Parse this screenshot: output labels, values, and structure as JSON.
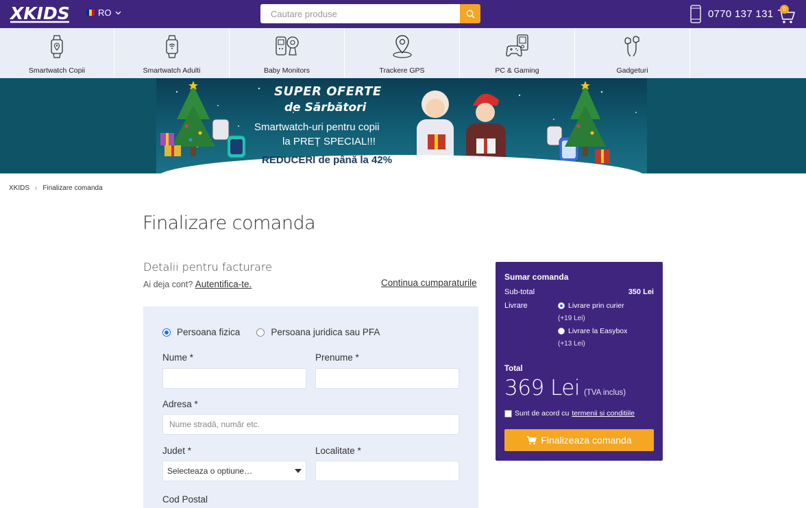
{
  "header": {
    "logo_text": "XKIDS",
    "language": "RO",
    "search_placeholder": "Cautare produse",
    "phone": "0770 137 131",
    "cart_count": "0"
  },
  "categories": [
    {
      "label": "Smartwatch Copii",
      "icon": "smartwatch-pin-icon"
    },
    {
      "label": "Smartwatch Adulti",
      "icon": "smartwatch-wifi-icon"
    },
    {
      "label": "Baby Monitors",
      "icon": "baby-monitor-icon"
    },
    {
      "label": "Trackere GPS",
      "icon": "gps-pin-icon"
    },
    {
      "label": "PC & Gaming",
      "icon": "gamepad-icon"
    },
    {
      "label": "Gadgeturi",
      "icon": "earphones-icon"
    }
  ],
  "banner": {
    "title_line1": "SUPER OFERTE",
    "title_line2": "de Sărbători",
    "sub_line1": "Smartwatch-uri pentru copii",
    "sub_line2": "la PREȚ SPECIAL!!!",
    "sub_line3": "REDUCERI de până la 42%"
  },
  "breadcrumb": {
    "home": "XKIDS",
    "current": "Finalizare comanda"
  },
  "page": {
    "title": "Finalizare comanda",
    "billing_title": "Detalii pentru facturare",
    "account_prompt": "Ai deja cont?",
    "login_link": "Autentifica-te.",
    "continue_link": "Continua cumparaturile"
  },
  "form": {
    "type_person": "Persoana fizica",
    "type_company": "Persoana juridica sau PFA",
    "selected_type": "Persoana fizica",
    "nume_label": "Nume *",
    "nume_value": "",
    "prenume_label": "Prenume *",
    "prenume_value": "",
    "adresa_label": "Adresa *",
    "adresa_placeholder": "Nume stradă, număr etc.",
    "judet_label": "Judet *",
    "judet_selected": "Selecteaza o optiune…",
    "localitate_label": "Localitate *",
    "localitate_value": "",
    "cod_postal_label": "Cod Postal"
  },
  "summary": {
    "title": "Sumar comanda",
    "subtotal_label": "Sub-total",
    "subtotal_value": "350 Lei",
    "delivery_label": "Livrare",
    "delivery_options": [
      {
        "label": "Livrare prin curier",
        "price": "(+19 Lei)",
        "selected": true
      },
      {
        "label": "Livrare la Easybox",
        "price": "(+13 Lei)",
        "selected": false
      }
    ],
    "total_label": "Total",
    "total_value": "369 Lei",
    "tva_note": "(TVA inclus)",
    "terms_prefix": "Sunt de acord cu",
    "terms_link": "termenii si conditiile",
    "terms_checked": false,
    "finish_button": "Finalizeaza comanda"
  },
  "colors": {
    "brand_purple": "#40257f",
    "accent_orange": "#f5a623",
    "nav_bg": "#e9edf5",
    "form_bg": "#e9eef8"
  }
}
